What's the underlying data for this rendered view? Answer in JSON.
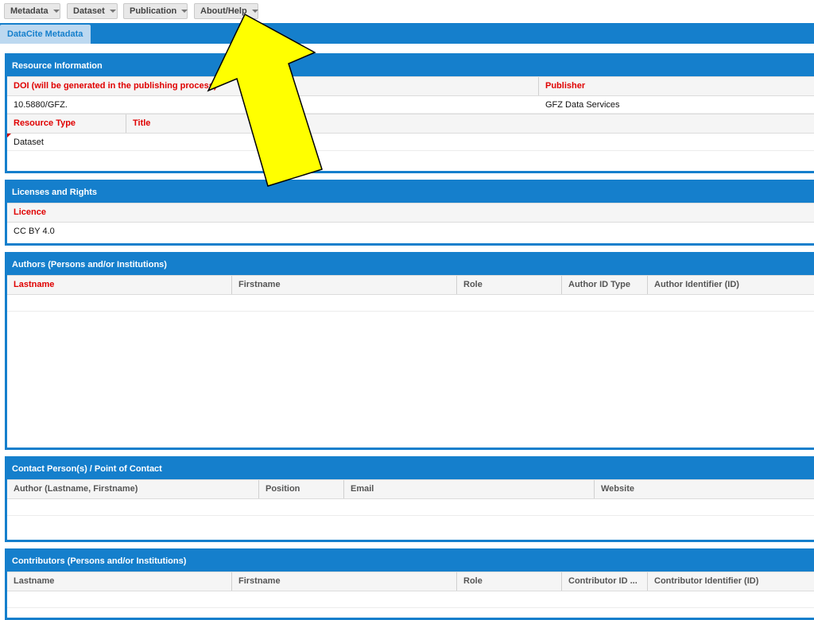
{
  "menubar": {
    "items": [
      "Metadata",
      "Dataset",
      "Publication",
      "About/Help"
    ]
  },
  "tabs": {
    "active": "DataCite Metadata"
  },
  "resource_info": {
    "title": "Resource Information",
    "doi_header": "DOI (will be generated in the publishing process)",
    "publisher_header": "Publisher",
    "doi_value": "10.5880/GFZ.",
    "publisher_value": "GFZ Data Services",
    "resource_type_header": "Resource Type",
    "title_header": "Title",
    "resource_type_value": "Dataset"
  },
  "licenses": {
    "title": "Licenses and Rights",
    "licence_header": "Licence",
    "licence_value": "CC BY 4.0"
  },
  "authors": {
    "title": "Authors (Persons and/or Institutions)",
    "columns": [
      "Lastname",
      "Firstname",
      "Role",
      "Author ID Type",
      "Author Identifier (ID)"
    ]
  },
  "contacts": {
    "title": "Contact Person(s) / Point of Contact",
    "columns": [
      "Author (Lastname, Firstname)",
      "Position",
      "Email",
      "Website"
    ]
  },
  "contributors": {
    "title": "Contributors (Persons and/or Institutions)",
    "columns": [
      "Lastname",
      "Firstname",
      "Role",
      "Contributor ID ...",
      "Contributor Identifier (ID)"
    ]
  },
  "colors": {
    "accent": "#157fcc",
    "required": "#e00000",
    "arrow_fill": "#ffff00"
  },
  "overlay": {
    "arrow_icon": "yellow-arrow-icon"
  }
}
